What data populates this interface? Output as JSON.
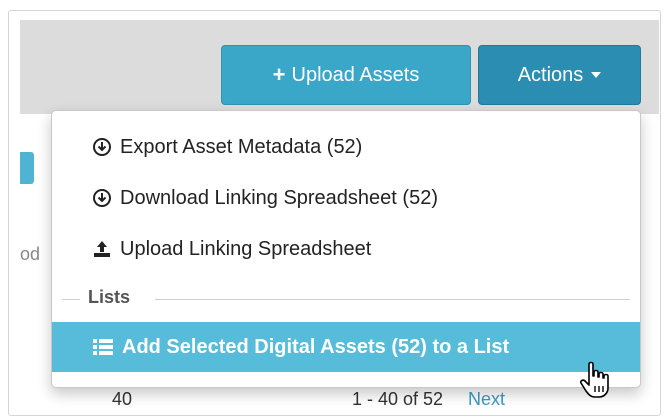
{
  "toolbar": {
    "upload_label": "Upload Assets",
    "upload_icon": "plus-icon",
    "actions_label": "Actions",
    "actions_icon": "caret-down-icon"
  },
  "background": {
    "left_text": "od",
    "bottom_left": "40",
    "bottom_mid": "1 - 40 of 52",
    "bottom_next": "Next"
  },
  "menu": {
    "items": [
      {
        "label": "Export Asset Metadata (52)",
        "icon": "download-circle-icon"
      },
      {
        "label": "Download Linking Spreadsheet (52)",
        "icon": "download-circle-icon"
      },
      {
        "label": "Upload Linking Spreadsheet",
        "icon": "upload-icon"
      }
    ],
    "section_header": "Lists",
    "active_item": {
      "label": "Add Selected Digital Assets (52) to a List",
      "icon": "list-icon"
    }
  },
  "colors": {
    "upload_button": "#3aa7c9",
    "actions_button": "#2a8db1",
    "active_item": "#56bcd9"
  }
}
